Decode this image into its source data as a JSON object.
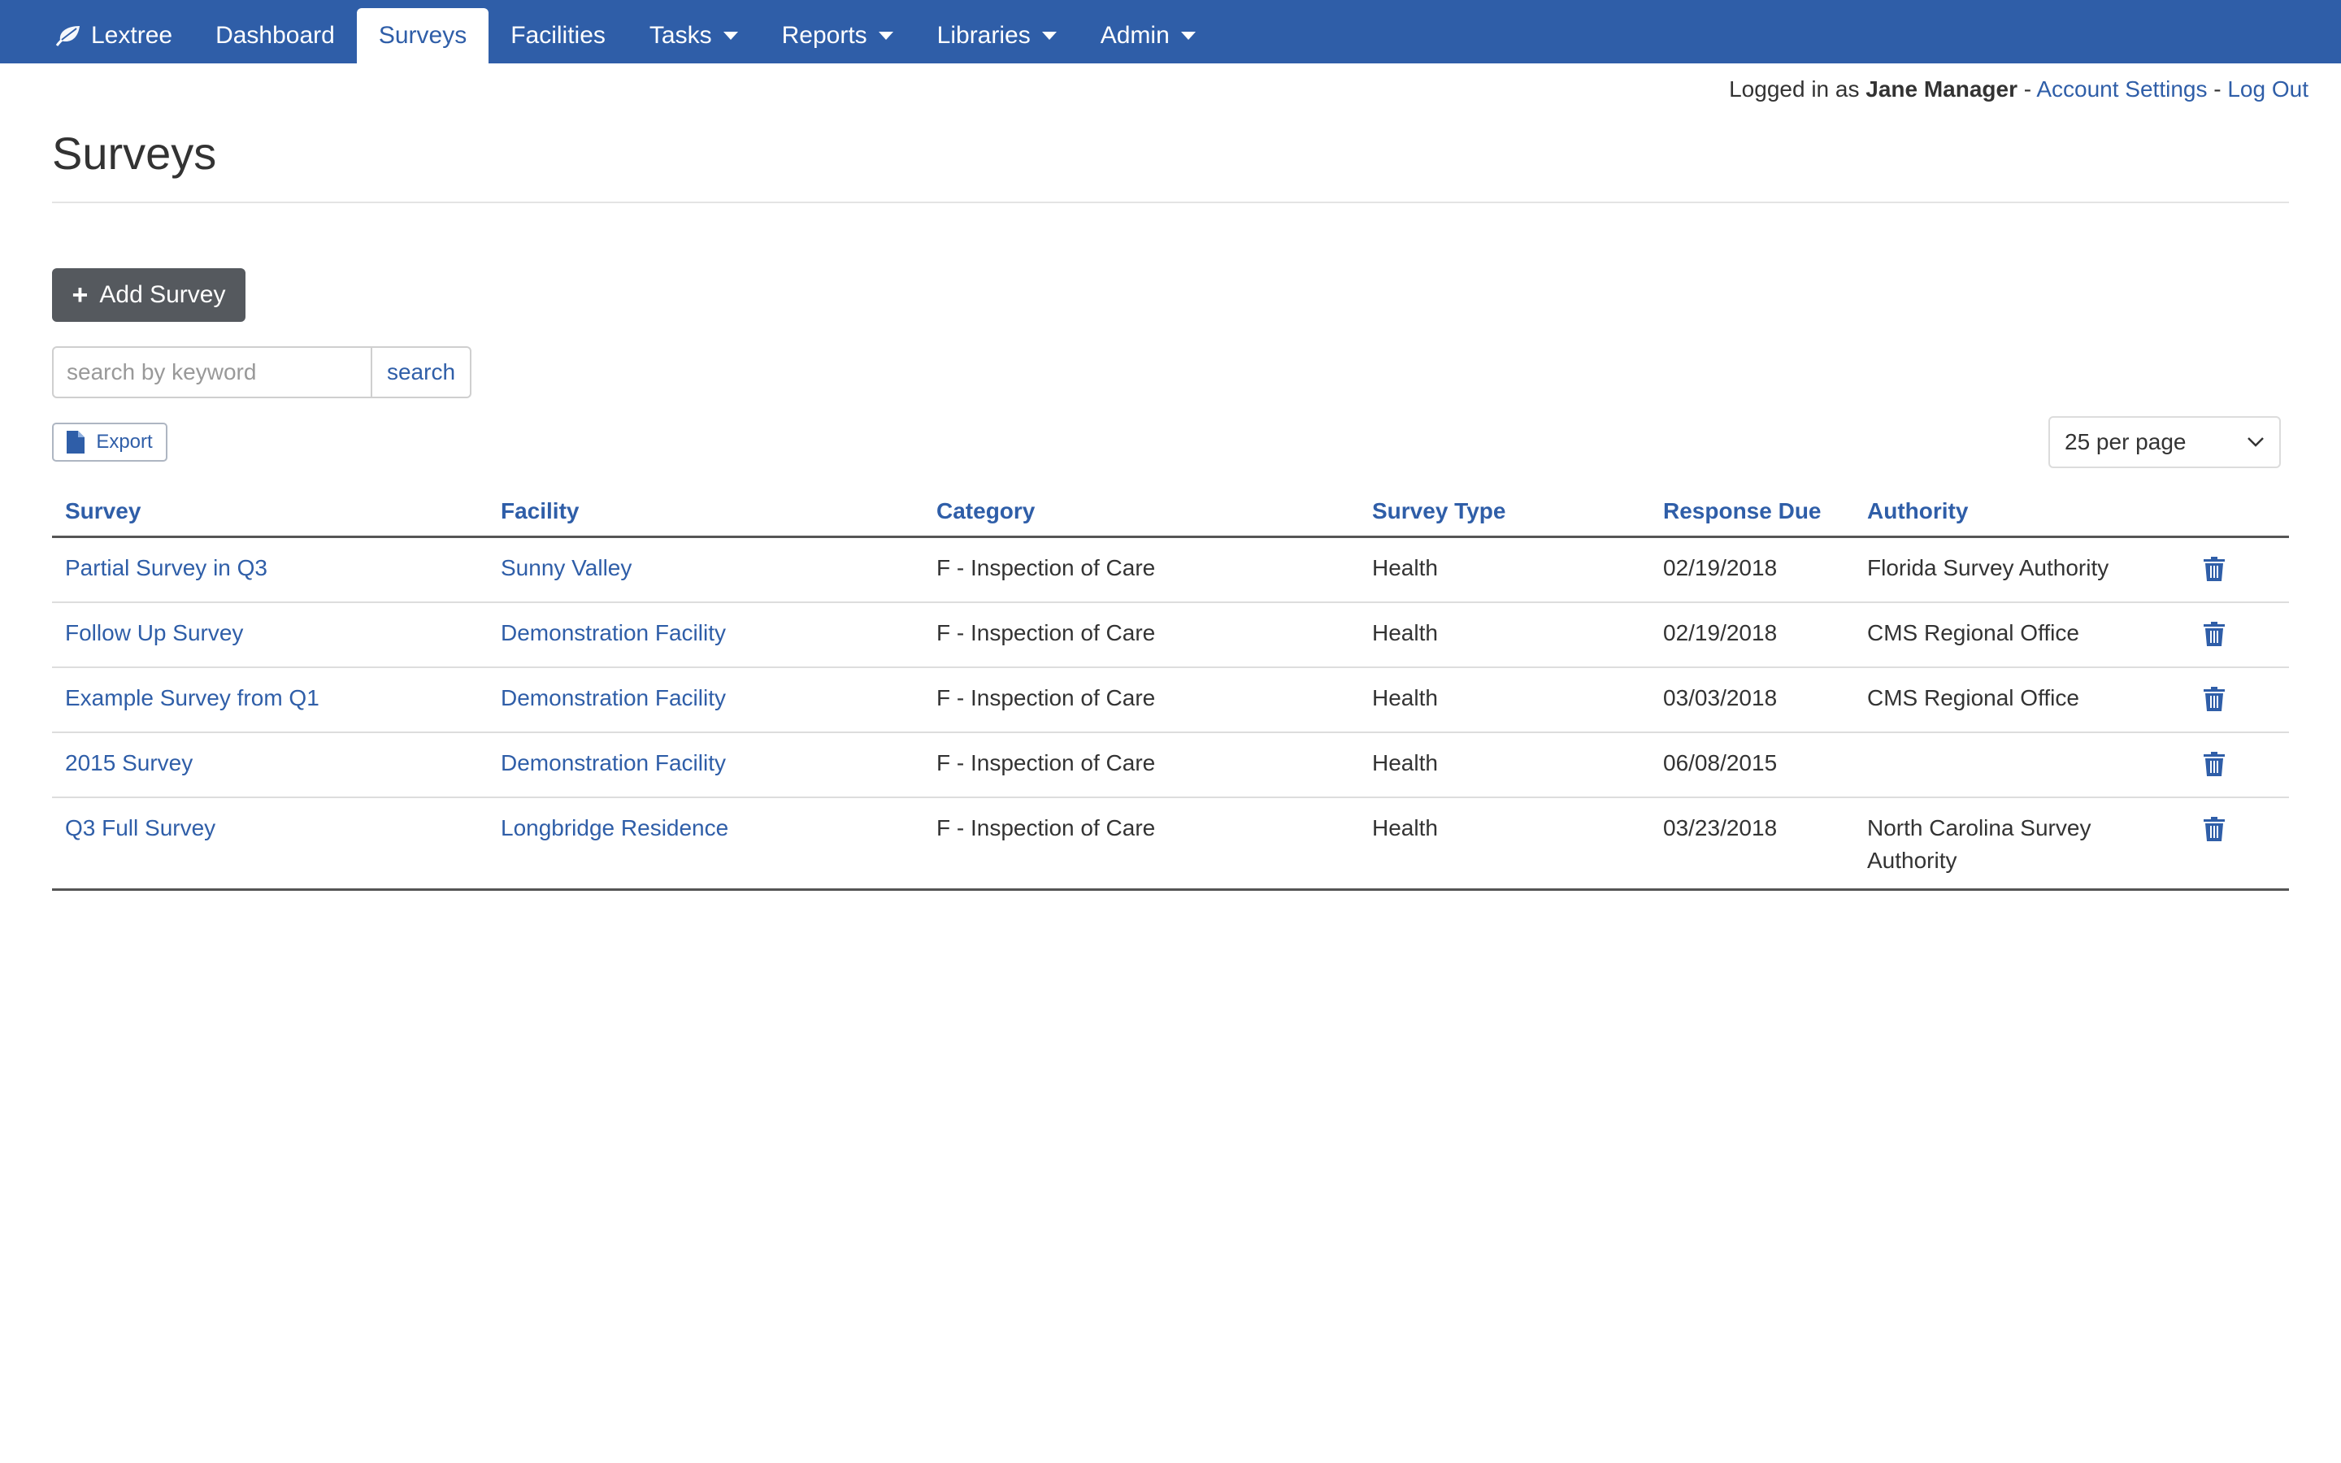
{
  "nav": {
    "brand": "Lextree",
    "items": [
      {
        "label": "Dashboard",
        "active": false,
        "dropdown": false
      },
      {
        "label": "Surveys",
        "active": true,
        "dropdown": false
      },
      {
        "label": "Facilities",
        "active": false,
        "dropdown": false
      },
      {
        "label": "Tasks",
        "active": false,
        "dropdown": true
      },
      {
        "label": "Reports",
        "active": false,
        "dropdown": true
      },
      {
        "label": "Libraries",
        "active": false,
        "dropdown": true
      },
      {
        "label": "Admin",
        "active": false,
        "dropdown": true
      }
    ],
    "color": "#2f5ea8"
  },
  "userbar": {
    "prefix": "Logged in as",
    "user": "Jane Manager",
    "sep": "-",
    "account_settings": "Account Settings",
    "logout": "Log Out"
  },
  "page": {
    "title": "Surveys",
    "add_button": "Add Survey",
    "search_placeholder": "search by keyword",
    "search_value": "",
    "search_button": "search",
    "export_button": "Export",
    "per_page": "25 per page"
  },
  "table": {
    "columns": [
      "Survey",
      "Facility",
      "Category",
      "Survey Type",
      "Response Due",
      "Authority"
    ],
    "rows": [
      {
        "survey": "Partial Survey in Q3",
        "facility": "Sunny Valley",
        "category": "F - Inspection of Care",
        "type": "Health",
        "due": "02/19/2018",
        "authority": "Florida Survey Authority"
      },
      {
        "survey": "Follow Up Survey",
        "facility": "Demonstration Facility",
        "category": "F - Inspection of Care",
        "type": "Health",
        "due": "02/19/2018",
        "authority": "CMS Regional Office"
      },
      {
        "survey": "Example Survey from Q1",
        "facility": "Demonstration Facility",
        "category": "F - Inspection of Care",
        "type": "Health",
        "due": "03/03/2018",
        "authority": "CMS Regional Office"
      },
      {
        "survey": "2015 Survey",
        "facility": "Demonstration Facility",
        "category": "F - Inspection of Care",
        "type": "Health",
        "due": "06/08/2015",
        "authority": ""
      },
      {
        "survey": "Q3 Full Survey",
        "facility": "Longbridge Residence",
        "category": "F - Inspection of Care",
        "type": "Health",
        "due": "03/23/2018",
        "authority": "North Carolina Survey Authority"
      }
    ]
  },
  "icons": {
    "brand": "leaf-icon",
    "add": "plus-icon",
    "export": "file-icon",
    "per_page": "chevron-down-icon",
    "row_action": "trash-icon"
  }
}
